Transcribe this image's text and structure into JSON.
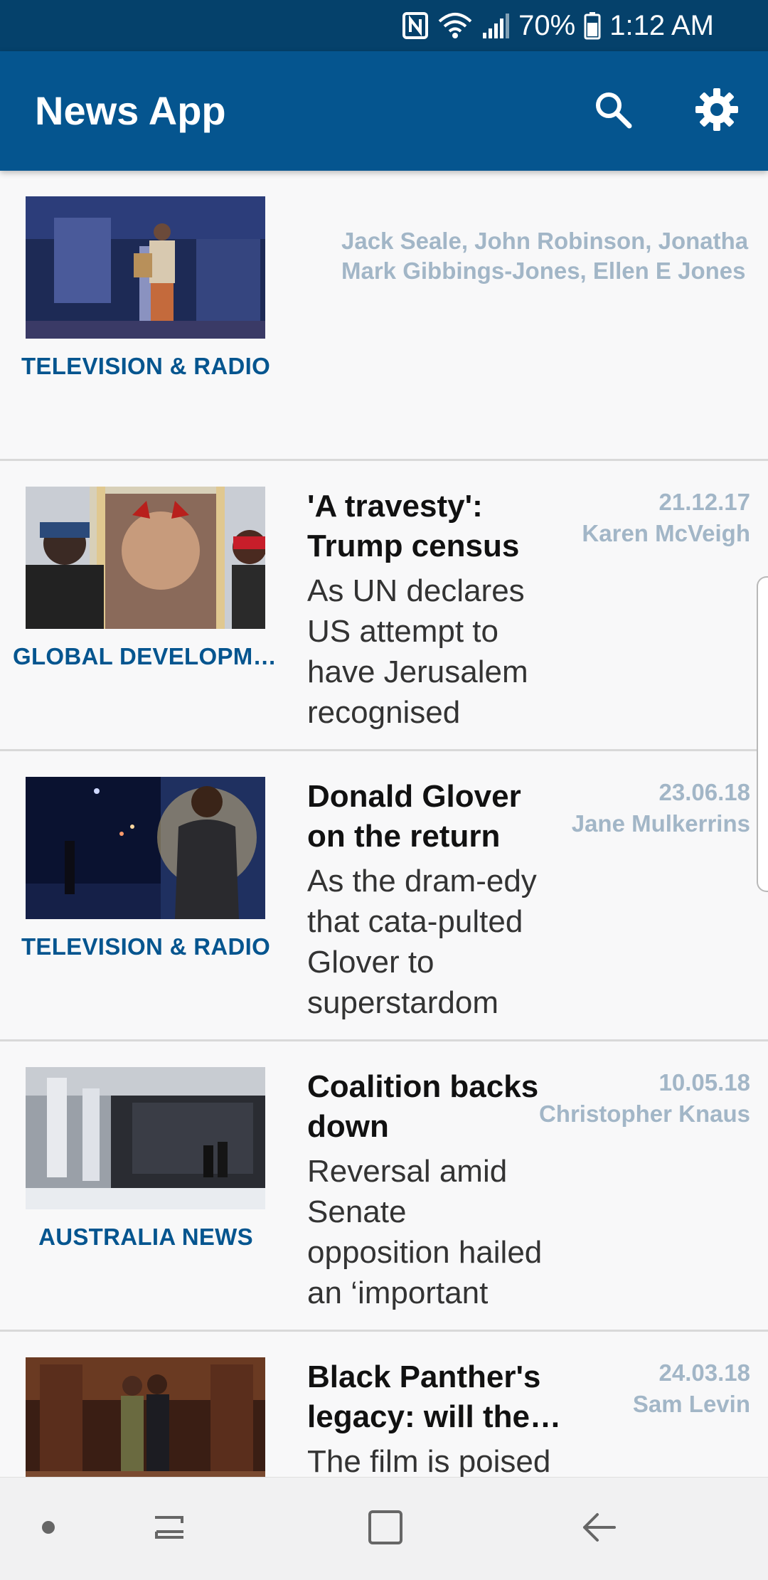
{
  "status_bar": {
    "battery": "70%",
    "time": "1:12 AM",
    "icons": [
      "nfc-icon",
      "wifi-icon",
      "signal-icon",
      "battery-icon"
    ]
  },
  "app_bar": {
    "title": "News App",
    "actions": [
      "search-icon",
      "settings-icon"
    ],
    "color": "#05558f"
  },
  "articles": [
    {
      "section": "TELEVISION & RADIO",
      "headline": "",
      "standfirst": "",
      "date": "",
      "byline": "Jack Seale, John Robinson, Jonatha\nMark Gibbings-Jones, Ellen E Jones"
    },
    {
      "section": "GLOBAL DEVELOPMENT",
      "headline": "'A travesty': Trump census",
      "standfirst": "As UN declares US attempt to have Jerusalem recognised",
      "date": "21.12.17",
      "byline": "Karen McVeigh"
    },
    {
      "section": "TELEVISION & RADIO",
      "headline": "Donald Glover on the return",
      "standfirst": "As the dram-edy that cata-pulted Glover to superstardom",
      "date": "23.06.18",
      "byline": "Jane Mulkerrins"
    },
    {
      "section": "AUSTRALIA NEWS",
      "headline": "Coalition backs down",
      "standfirst": "Reversal amid Senate opposition hailed an ‘important",
      "date": "10.05.18",
      "byline": "Christopher Knaus"
    },
    {
      "section": "",
      "headline": "Black Panther's legacy: will the rest",
      "standfirst": "The film is poised",
      "date": "24.03.18",
      "byline": "Sam Levin"
    }
  ],
  "nav_bar": {
    "buttons": [
      "dot-icon",
      "recents-icon",
      "home-icon",
      "back-icon"
    ]
  },
  "colors": {
    "status_bar": "#05416b",
    "accent": "#05558f",
    "meta_text": "#a2b6c7"
  }
}
